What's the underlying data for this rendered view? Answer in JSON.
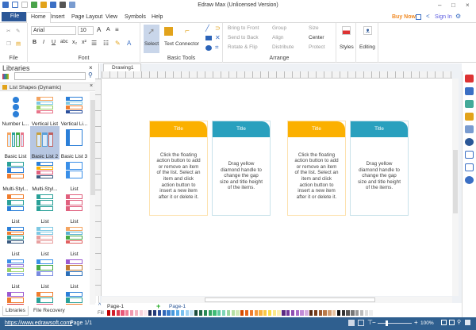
{
  "app": {
    "title": "Edraw Max (Unlicensed Version)"
  },
  "tabs": [
    "File",
    "Home",
    "Insert",
    "Page Layout",
    "View",
    "Symbols",
    "Help"
  ],
  "header_right": {
    "buy_now": "Buy Now",
    "sign_in": "Sign In"
  },
  "ribbon": {
    "font": {
      "name": "Arial",
      "size": "10"
    },
    "groups": {
      "file": "File",
      "font": "Font",
      "basic_tools": "Basic Tools",
      "arrange": "Arrange"
    },
    "tools": {
      "select": "Select",
      "text": "Text",
      "connector": "Connector"
    },
    "arrange": [
      "Bring to Front",
      "Send to Back",
      "Rotate & Flip",
      "Group",
      "Align",
      "Distribute",
      "Size",
      "Center",
      "Protect"
    ],
    "styles": "Styles",
    "editing": "Editing"
  },
  "libraries": {
    "title": "Libraries",
    "category": "List Shapes (Dynamic)",
    "shapes": [
      "Number L...",
      "Vertical List",
      "Vertical Li...",
      "Basic List",
      "Basic List 2",
      "Basic List 3",
      "Multi-Styl...",
      "Multi-Styl...",
      "List",
      "List",
      "List",
      "List",
      "List",
      "List",
      "List",
      "List",
      "List",
      "List",
      "",
      "",
      ""
    ],
    "tabs": [
      "Libraries",
      "File Recovery"
    ]
  },
  "document": {
    "tab": "Drawing1"
  },
  "cards": [
    {
      "title": "Title",
      "body": "Click the floating action button to add or remove an item of the list. Select an item and click action button to insert a new item after it or delete it.",
      "color": "#fbb000"
    },
    {
      "title": "Title",
      "body": "Drag yellow diamond handle to change the gap size and title height of the items.",
      "color": "#29a0be"
    },
    {
      "title": "Title",
      "body": "Click the floating action button to add or remove an item of the list. Select an item and click action button to insert a new item after it or delete it.",
      "color": "#fbb000"
    },
    {
      "title": "Title",
      "body": "Drag yellow diamond handle to change the gap size and title height of the items.",
      "color": "#29a0be"
    }
  ],
  "pages": {
    "selector": "Page-1",
    "active": "Page-1",
    "fill_label": "Fill"
  },
  "palette": [
    "#c00000",
    "#d4202c",
    "#e03c50",
    "#e8587a",
    "#ef7d96",
    "#f29ab0",
    "#f5b6c4",
    "#f9d0da",
    "#fde8ee",
    "#1f2d5a",
    "#243c7c",
    "#2b4f9c",
    "#3066b8",
    "#3a7fcf",
    "#4697dc",
    "#56acea",
    "#79c0f0",
    "#9fd2f3",
    "#c6e3f6",
    "#1b4d3e",
    "#226b4a",
    "#2a8a56",
    "#34a564",
    "#3fbb76",
    "#5fcaa0",
    "#7fd6b8",
    "#9ad7a0",
    "#b5e0a4",
    "#d0ebb8",
    "#d64b00",
    "#e6641a",
    "#f07d2e",
    "#f59a3d",
    "#f8b23f",
    "#fac843",
    "#fbdc4a",
    "#fbe98a",
    "#fcf0b4",
    "#5b2a82",
    "#75389c",
    "#8e4fb3",
    "#a86cc7",
    "#c18bd7",
    "#d6acdf",
    "#5a2d14",
    "#7a3f1d",
    "#9b5a2f",
    "#b97a4a",
    "#d29e72",
    "#e6c3a2",
    "#111111",
    "#333333",
    "#555555",
    "#777777",
    "#999999",
    "#bbbbbb",
    "#dddddd",
    "#eeeeee"
  ],
  "status": {
    "url": "https://www.edrawsoft.com/",
    "page": "Page 1/1",
    "zoom": "100%"
  }
}
